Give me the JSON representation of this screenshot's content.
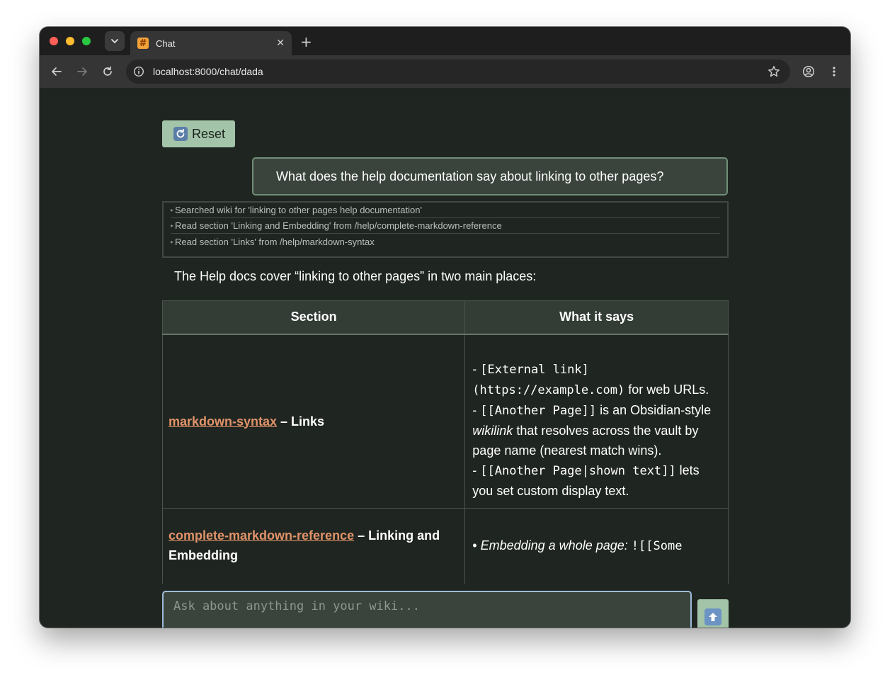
{
  "browser": {
    "tab_title": "Chat",
    "tab_favicon": "#",
    "url": "localhost:8000/chat/dada",
    "icons": [
      "tab-dropdown-icon",
      "close-icon",
      "new-tab-icon",
      "back-icon",
      "forward-icon",
      "reload-icon",
      "site-info-icon",
      "bookmark-star-icon",
      "profile-icon",
      "menu-icon"
    ]
  },
  "chat": {
    "reset_label": "Reset",
    "user_message": "What does the help documentation say about linking to other pages?",
    "tool_calls": [
      "Searched wiki for 'linking to other pages help documentation'",
      "Read section 'Linking and Embedding' from /help/complete-markdown-reference",
      "Read section 'Links' from /help/markdown-syntax"
    ],
    "answer_intro": "The Help docs cover “linking to other pages” in two main places:",
    "table": {
      "headers": [
        "Section",
        "What it says"
      ],
      "rows": [
        {
          "link": "markdown-syntax",
          "title": " – Links",
          "line1_code": "[External link](https://example.com)",
          "line1_text": " for web URLs.",
          "line2_code": "[[Another Page]]",
          "line2_text": " is an Obsidian-style ",
          "line2_em": "wikilink",
          "line2_text2": " that resolves across the vault by page name (nearest match wins).",
          "line3_code": "[[Another Page|shown text]]",
          "line3_text": " lets you set custom display text."
        },
        {
          "link": "complete-markdown-reference",
          "title": " – Linking and Embedding",
          "line1_em": "Embedding a whole page:",
          "line1_code": "![[Some"
        }
      ]
    },
    "input_placeholder": "Ask about anything in your wiki..."
  },
  "colors": {
    "page_bg": "#1f2520",
    "accent_button": "#a3c4a9",
    "link": "#e0936a",
    "input_border": "#9dbbd8"
  }
}
